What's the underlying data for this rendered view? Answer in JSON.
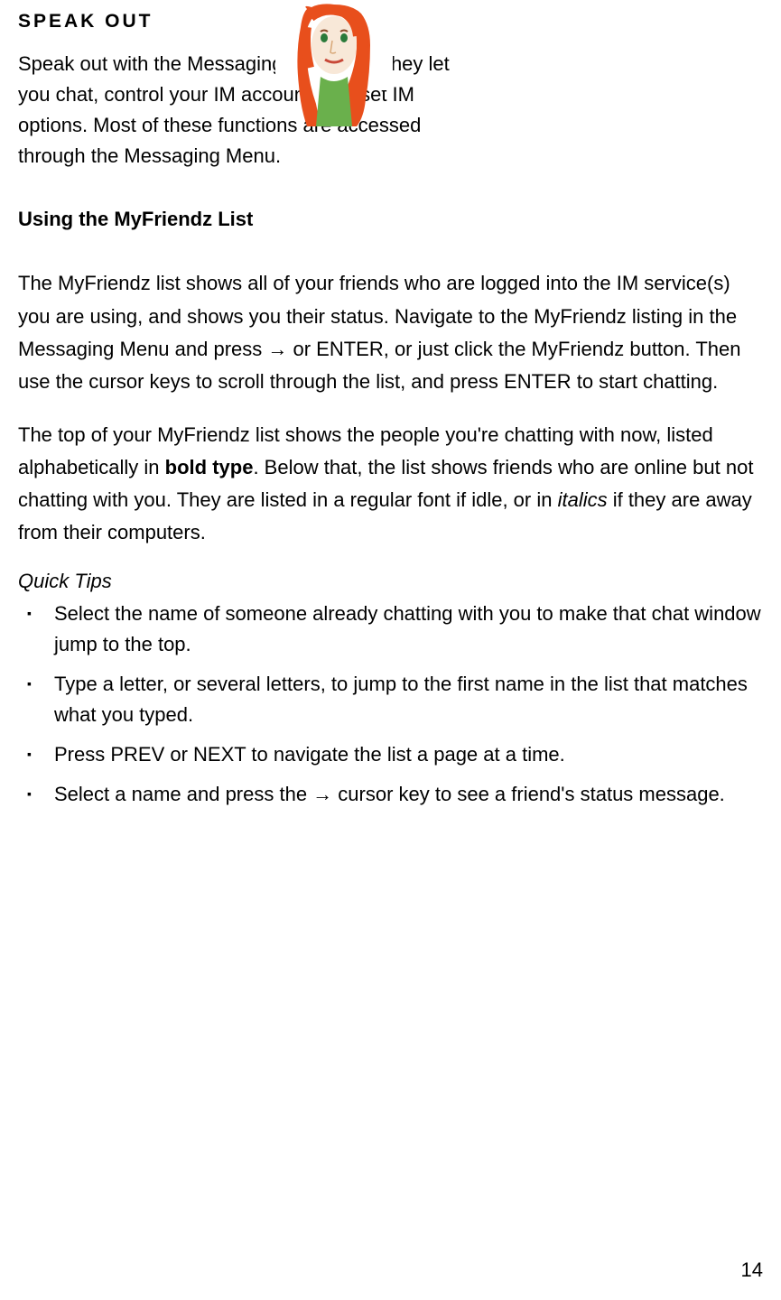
{
  "header": {
    "title": "SPEAK OUT"
  },
  "intro": {
    "text": "Speak out with the Messaging functions!  They let you chat, control your IM account, and set IM options.   Most of these functions are accessed through the Messaging Menu."
  },
  "section": {
    "heading": "Using the MyFriendz List"
  },
  "para1": {
    "part1": "The MyFriendz list shows all of your friends who are logged into the IM service(s) you are using, and shows you their status.   Navigate to the MyFriendz listing in the Messaging Menu and press ",
    "arrow": "→",
    "part2": " or ENTER, or just click the MyFriendz button.   Then use the cursor keys to scroll through the list, and press ENTER to start chatting."
  },
  "para2": {
    "part1": "The top of your MyFriendz list shows the people you're chatting with now, listed alphabetically in ",
    "bold": "bold type",
    "part2": ". Below that, the list shows friends who are online but not chatting with you. They are listed in a regular font if idle, or in ",
    "italic": "italics",
    "part3": " if they are away from their computers."
  },
  "quickTips": {
    "label": "Quick Tips",
    "items": [
      "Select the name of someone already chatting with you to make that chat window jump to the top.",
      "Type a letter, or several letters, to jump to the first name in the list that matches what you typed.",
      "Press PREV or NEXT to navigate the list a page at a time."
    ],
    "lastItem": {
      "part1": "Select a name and press the ",
      "arrow": "→",
      "part2": " cursor key to see a friend's status message."
    }
  },
  "pageNumber": "14"
}
